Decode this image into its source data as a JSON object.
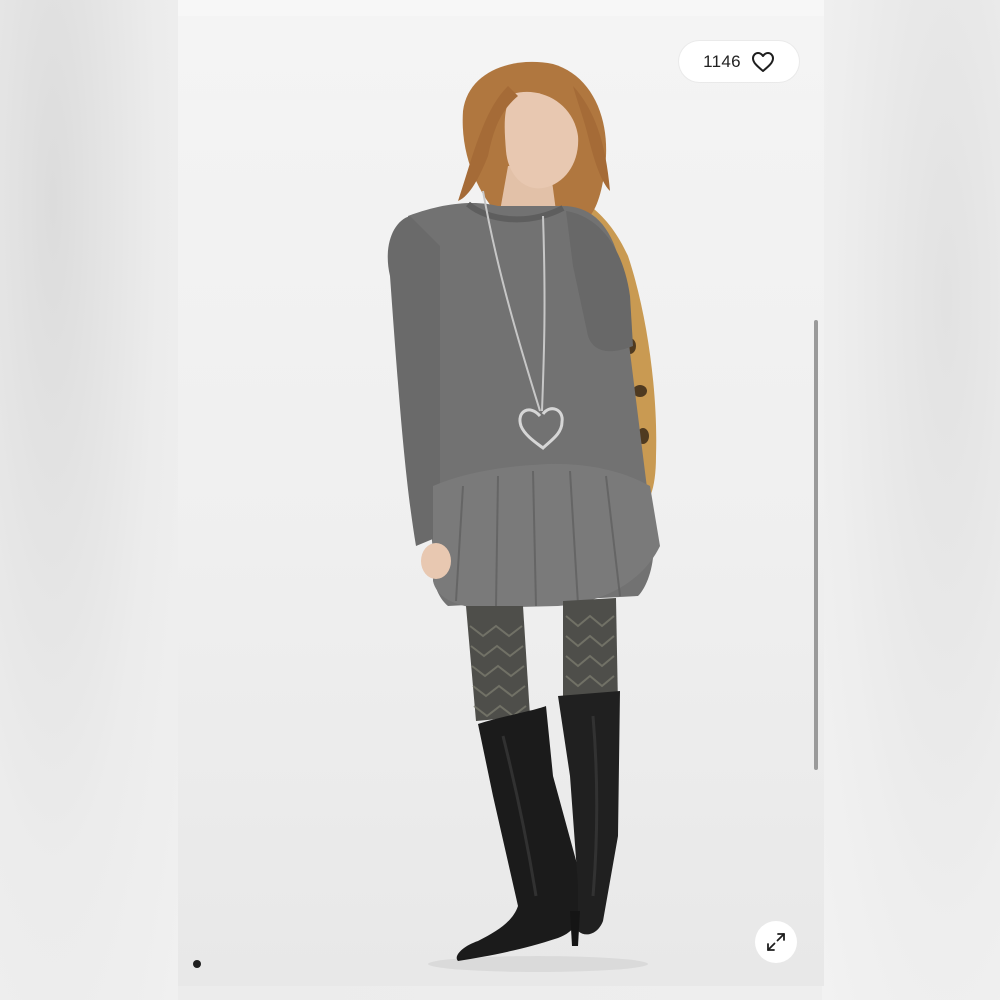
{
  "like_button": {
    "count": "1146",
    "icon": "heart-outline-icon"
  },
  "expand_button": {
    "icon": "expand-arrows-icon"
  },
  "pagination": {
    "active_index": 1,
    "total": 1
  },
  "colors": {
    "dress": "#6f6f6f",
    "boots": "#1b1b1b",
    "hair": "#b0773f",
    "leopard": "#c99a52",
    "tights": "#4e4e4a",
    "background": "#eeeeee"
  }
}
